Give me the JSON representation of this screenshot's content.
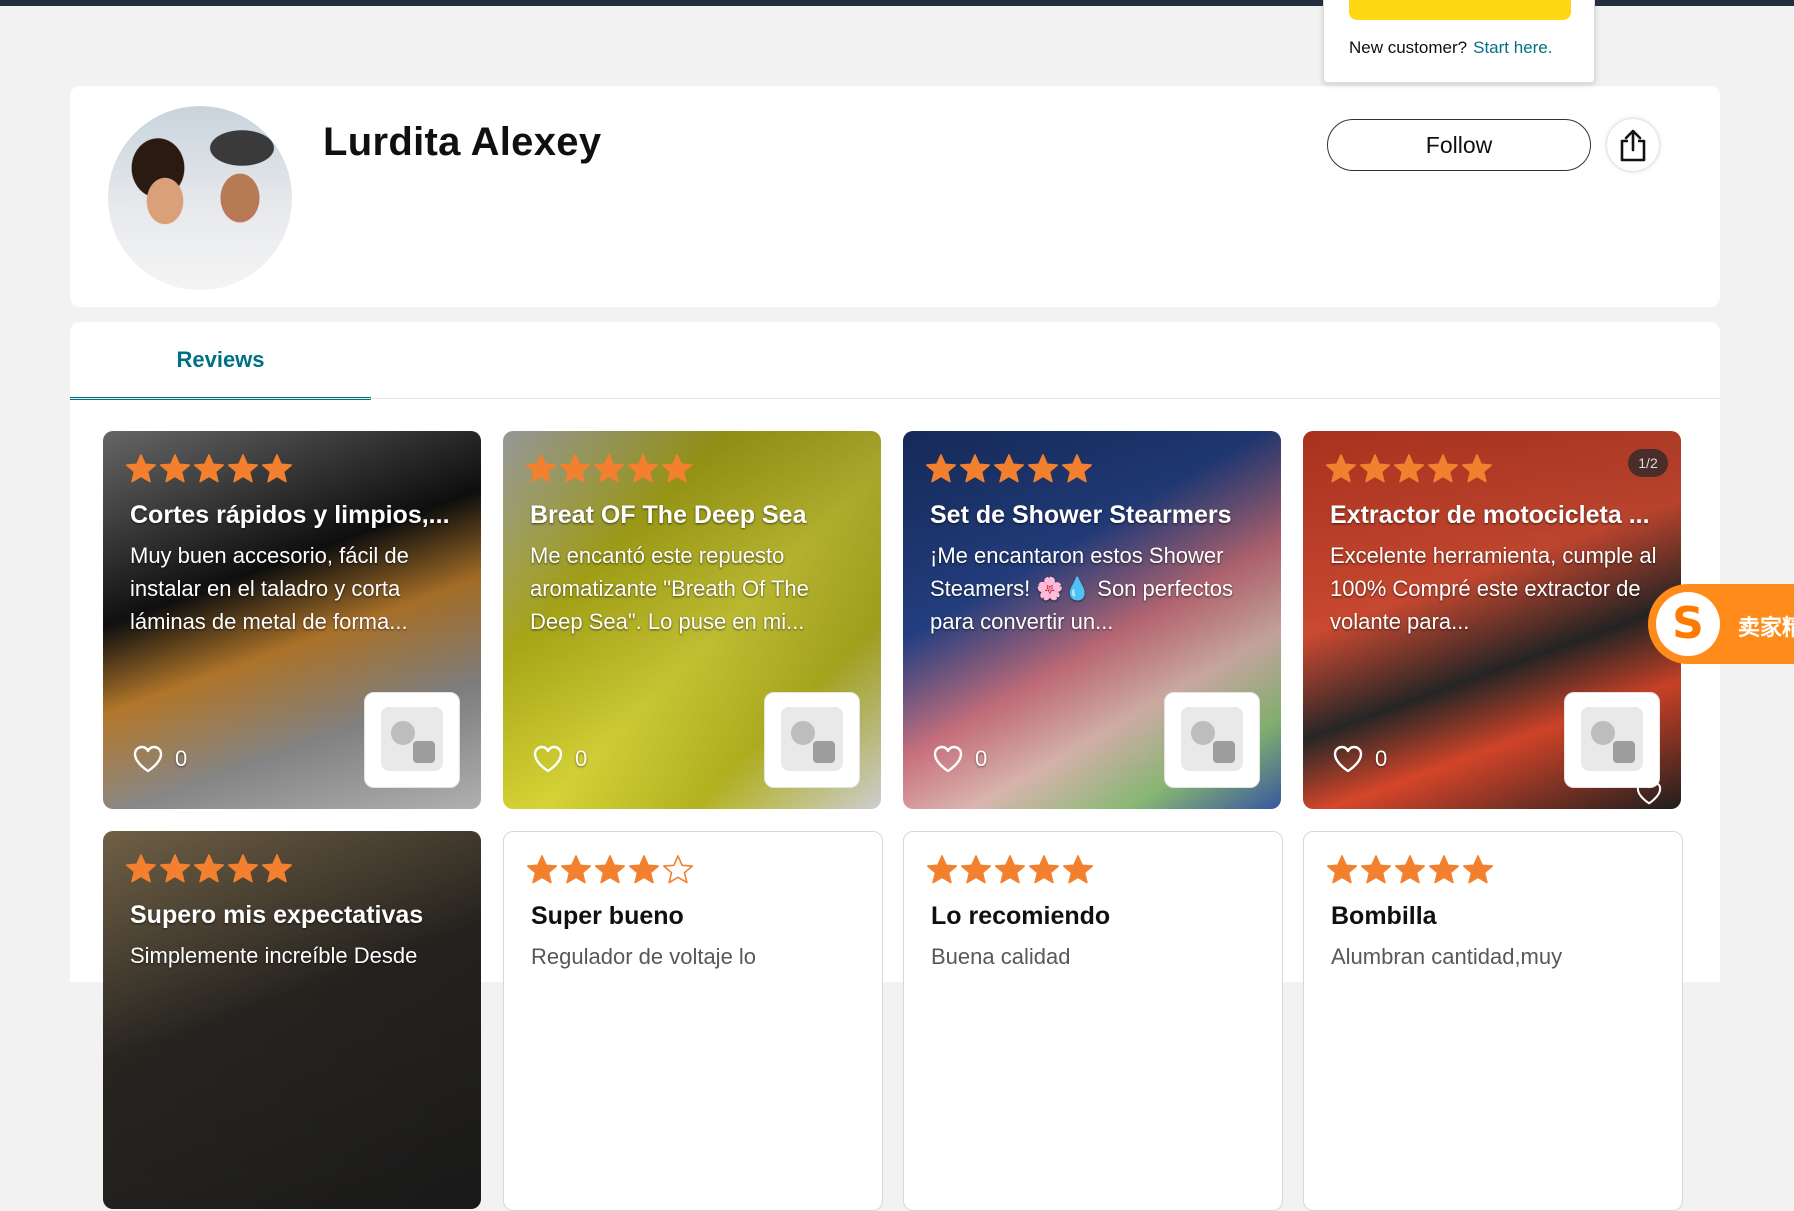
{
  "signin_flyout": {
    "new_customer_label": "New customer?",
    "start_here_link": "Start here."
  },
  "profile": {
    "name": "Lurdita Alexey",
    "follow_label": "Follow",
    "avatar_icon": "profile-photo"
  },
  "tabs": [
    {
      "label": "Reviews",
      "active": true
    }
  ],
  "colors": {
    "star": "#f3802e",
    "accent": "#007185",
    "signin_button": "#ffd814",
    "extension": "#ff8c1a"
  },
  "reviews": [
    {
      "rating": 5,
      "title": "Cortes rápidos y limpios,...",
      "body": "Muy buen accesorio, fácil de instalar en el taladro y corta láminas de metal de forma...",
      "likes": "0",
      "product_icon": "drill-attachment-icon",
      "bg": "linear-gradient(160deg,#8c8c8c 0%,#4b4b4b 20%,#121212 38%,#c9862f 55%,#8f8f8f 75%,#b9b9b9 100%)"
    },
    {
      "rating": 5,
      "title": "Breat OF The Deep Sea",
      "body": "Me encantó este repuesto aromatizante \"Breath Of The Deep Sea\". Lo puse en mi...",
      "likes": "0",
      "product_icon": "air-freshener-icon",
      "bg": "linear-gradient(135deg,#cfd0d2 0%,#c6c31c 30%,#e2df3a 55%,#bdbc22 75%,#d8d8da 100%)"
    },
    {
      "rating": 5,
      "title": "Set de Shower Stearmers",
      "body": "¡Me encantaron estos Shower Steamers! 🌸💧 Son perfectos para convertir un...",
      "likes": "0",
      "product_icon": "shower-steamer-icon",
      "bg": "linear-gradient(150deg,#1d3a7a 0%,#2a4a98 35%,#d97a88 55%,#e6c0b8 70%,#8fc27a 85%,#3a5aa8 100%)"
    },
    {
      "rating": 5,
      "title": "Extractor de motocicleta ...",
      "body": "Excelente herramienta, cumple al 100% Compré este extractor de volante para...",
      "likes": "0",
      "badge": "1/2",
      "product_icon": "extractor-kit-icon",
      "bg": "linear-gradient(160deg,#e9452a 0%,#f0573a 40%,#2a2a2a 60%,#e44a2c 75%,#1f1f1f 100%)"
    },
    {
      "rating": 5,
      "title": "Supero mis expectativas",
      "body": "Simplemente increíble Desde",
      "bg": "linear-gradient(160deg,#9a8460 0%,#2e2b26 45%,#1a1a1a 100%)"
    },
    {
      "rating": 4,
      "title": "Super bueno",
      "body": "Regulador de voltaje lo"
    },
    {
      "rating": 5,
      "title": "Lo recomiendo",
      "body": "Buena calidad"
    },
    {
      "rating": 5,
      "title": "Bombilla",
      "body": "Alumbran cantidad,muy"
    }
  ],
  "extension": {
    "text": "卖家精"
  }
}
